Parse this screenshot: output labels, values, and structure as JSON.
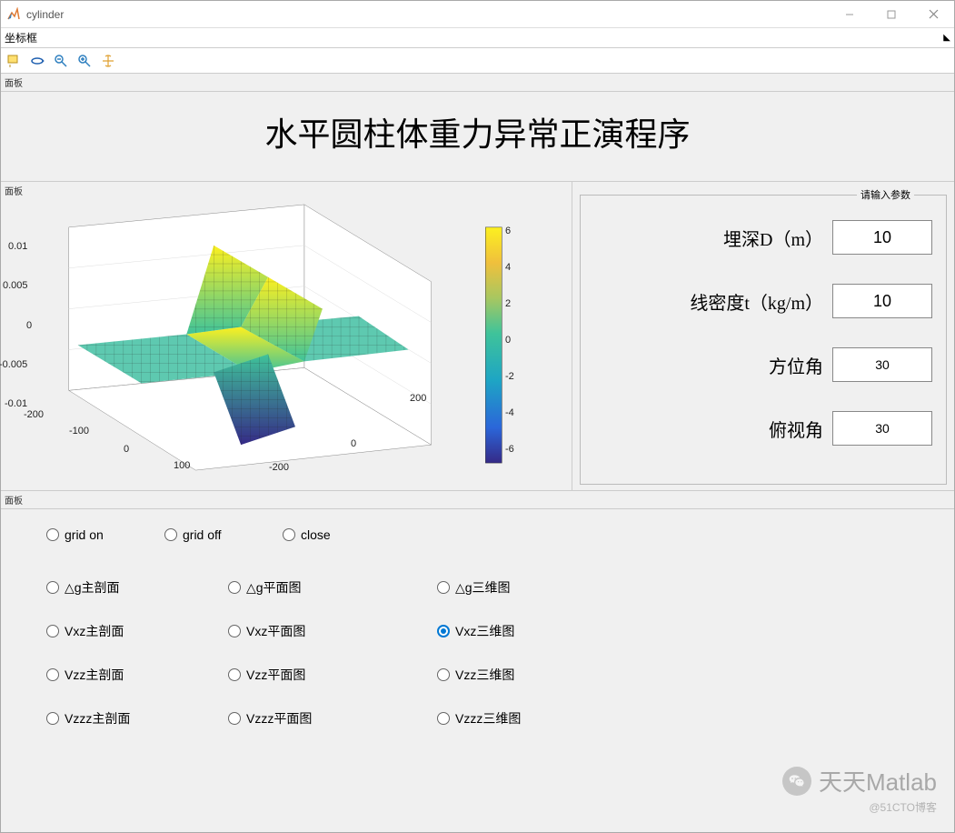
{
  "window": {
    "title": "cylinder"
  },
  "menubar": {
    "item": "坐标框"
  },
  "panel_label": "面板",
  "main_title": "水平圆柱体重力异常正演程序",
  "params": {
    "legend": "请输入参数",
    "depth_label": "埋深D（m）",
    "depth_value": "10",
    "density_label": "线密度t（kg/m）",
    "density_value": "10",
    "azimuth_label": "方位角",
    "azimuth_value": "30",
    "elevation_label": "俯视角",
    "elevation_value": "30"
  },
  "radios_row1": {
    "grid_on": "grid on",
    "grid_off": "grid off",
    "close": "close"
  },
  "radios_grid": {
    "dg_profile": "△g主剖面",
    "dg_plan": "△g平面图",
    "dg_3d": "△g三维图",
    "vxz_profile": "Vxz主剖面",
    "vxz_plan": "Vxz平面图",
    "vxz_3d": "Vxz三维图",
    "vzz_profile": "Vzz主剖面",
    "vzz_plan": "Vzz平面图",
    "vzz_3d": "Vzz三维图",
    "vzzz_profile": "Vzzz主剖面",
    "vzzz_plan": "Vzzz平面图",
    "vzzz_3d": "Vzzz三维图"
  },
  "selected_radio": "vxz_3d",
  "watermark": {
    "brand": "天天Matlab",
    "sub": "@51CTO博客"
  },
  "chart_data": {
    "type": "3d-surface",
    "title": "",
    "x_range": [
      -200,
      200
    ],
    "y_range": [
      -200,
      200
    ],
    "z_range": [
      -0.01,
      0.01
    ],
    "z_ticks": [
      -0.01,
      -0.005,
      0,
      0.005,
      0.01
    ],
    "x_ticks": [
      -200,
      -100,
      0,
      100
    ],
    "y_ticks": [
      -200,
      0,
      200
    ],
    "colorbar_range": [
      -6,
      6
    ],
    "colorbar_ticks": [
      -6,
      -4,
      -2,
      0,
      2,
      4,
      6
    ],
    "colormap": "parula",
    "description": "Vxz 3D surface: antisymmetric ridge along y-axis, positive lobe ~+6 at x<0 near center, negative lobe ~-6 at x>0 near center, flat ~0 elsewhere"
  }
}
